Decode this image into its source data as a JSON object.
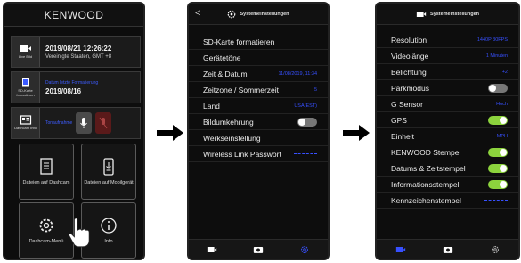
{
  "phone1": {
    "brand": "KENWOOD",
    "live_caption": "Live Bild",
    "datetime": "2019/08/21 12:26:22",
    "timezone": "Vereinigte Staaten, GMT +8",
    "sdcard_caption": "SD-Karte formatieren",
    "last_format_label": "Datum letzte Formatierung",
    "last_format_date": "2019/08/16",
    "dashcam_info_caption": "Dashcam Info",
    "voice_label": "Tonaufnahme",
    "tiles": {
      "files_dashcam": "Dateien auf Dashcam",
      "files_mobile": "Dateien auf Mobilgerät",
      "dashcam_menu": "Dashcam-Menü",
      "info": "Info"
    }
  },
  "phone2": {
    "back": "<",
    "title": "Systemeinstellungen",
    "rows": [
      {
        "label": "SD-Karte formatieren",
        "value": ""
      },
      {
        "label": "Gerätetöne",
        "value": ""
      },
      {
        "label": "Zeit & Datum",
        "value": "11/08/2019, 11:34"
      },
      {
        "label": "Zeitzone / Sommerzeit",
        "value": "5"
      },
      {
        "label": "Land",
        "value": "USA(EST)"
      },
      {
        "label": "Bildumkehrung",
        "value": ""
      },
      {
        "label": "Werkseinstellung",
        "value": ""
      },
      {
        "label": "Wireless Link Passwort",
        "value": ""
      }
    ],
    "bildumkehrung_on": false
  },
  "phone3": {
    "title": "Systemeinstellungen",
    "rows": [
      {
        "label": "Resolution",
        "value": "1440P 30FPS"
      },
      {
        "label": "Videolänge",
        "value": "1 Minuten"
      },
      {
        "label": "Belichtung",
        "value": "+2"
      },
      {
        "label": "Parkmodus",
        "value": ""
      },
      {
        "label": "G Sensor",
        "value": "Hoch"
      },
      {
        "label": "GPS",
        "value": ""
      },
      {
        "label": "Einheit",
        "value": "MPH"
      },
      {
        "label": "KENWOOD Stempel",
        "value": ""
      },
      {
        "label": "Datums & Zeitstempel",
        "value": ""
      },
      {
        "label": "Informationsstempel",
        "value": ""
      },
      {
        "label": "Kennzeichenstempel",
        "value": ""
      }
    ],
    "toggles": {
      "parkmodus": false,
      "gps": true,
      "kenwood_stempel": true,
      "datums_zeitstempel": true,
      "informationsstempel": true
    }
  },
  "colors": {
    "accent_blue": "#3750ff",
    "toggle_on": "#8cd33d",
    "toggle_off": "#777777",
    "arrow": "#000000"
  }
}
